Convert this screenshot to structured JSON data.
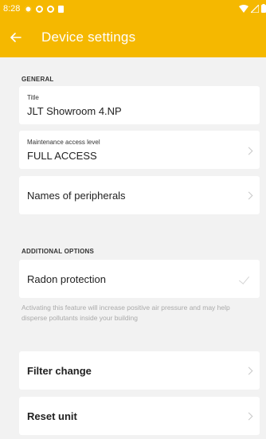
{
  "status_bar": {
    "time": "8:28"
  },
  "app_bar": {
    "title": "Device settings"
  },
  "general": {
    "heading": "GENERAL",
    "title_field": {
      "label": "Title",
      "value": "JLT Showroom 4.NP"
    },
    "access_field": {
      "label": "Maintenance access level",
      "value": "FULL ACCESS"
    },
    "peripherals": {
      "label": "Names of peripherals"
    }
  },
  "additional": {
    "heading": "ADDITIONAL OPTIONS",
    "radon": {
      "label": "Radon protection",
      "checked": true
    },
    "helper_text": "Activating this feature will increase positive air pressure and may help disperse pollutants inside your building",
    "filter_change": {
      "label": "Filter change"
    },
    "reset_unit": {
      "label": "Reset unit"
    }
  },
  "colors": {
    "accent": "#f5b800",
    "background": "#f2f2f2",
    "card": "#ffffff",
    "helper_text": "#aaaaaa"
  }
}
